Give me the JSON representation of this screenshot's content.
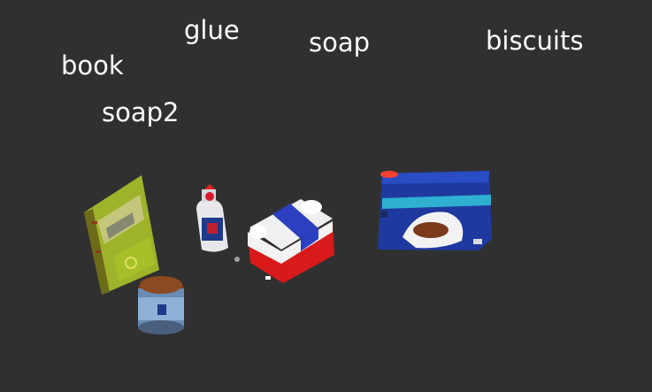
{
  "scene": {
    "labels": {
      "glue": "glue",
      "soap": "soap",
      "biscuits": "biscuits",
      "book": "book",
      "soap2": "soap2"
    },
    "background_color": "#303030"
  }
}
